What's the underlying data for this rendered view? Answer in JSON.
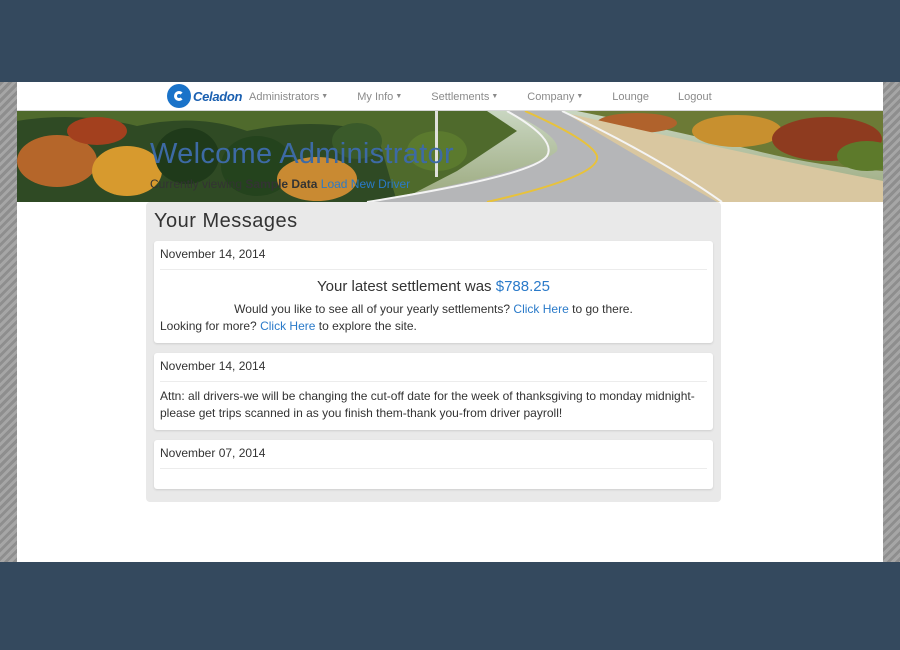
{
  "brand": {
    "logo_text": "Celadon"
  },
  "nav": {
    "items": [
      {
        "label": "Administrators",
        "dropdown": true
      },
      {
        "label": "My Info",
        "dropdown": true
      },
      {
        "label": "Settlements",
        "dropdown": true
      },
      {
        "label": "Company",
        "dropdown": true
      },
      {
        "label": "Lounge",
        "dropdown": false
      },
      {
        "label": "Logout",
        "dropdown": false
      }
    ]
  },
  "header": {
    "title": "Welcome Administrator",
    "viewing_prefix": "Currently viewing",
    "viewing_value": "Sample Data",
    "load_link": "Load New Driver"
  },
  "messages": {
    "title": "Your Messages",
    "items": [
      {
        "date": "November 14, 2014",
        "settlement_prefix": "Your latest settlement was",
        "settlement_amount": "$788.25",
        "line1_prefix": "Would you like to see all of your yearly settlements?",
        "line1_link": "Click Here",
        "line1_suffix": "to go there.",
        "line2_prefix": "Looking for more?",
        "line2_link": "Click Here",
        "line2_suffix": "to explore the site."
      },
      {
        "date": "November 14, 2014",
        "text": "Attn: all drivers-we will be changing the cut-off date for the week of thanksgiving to monday midnight-please get trips scanned in as you finish them-thank you-from driver payroll!"
      },
      {
        "date": "November 07, 2014"
      }
    ]
  },
  "colors": {
    "frame": "#34495e",
    "accent_blue": "#3d6aa5",
    "link_blue": "#2a7ac9",
    "panel_gray": "#e9e9e9"
  }
}
